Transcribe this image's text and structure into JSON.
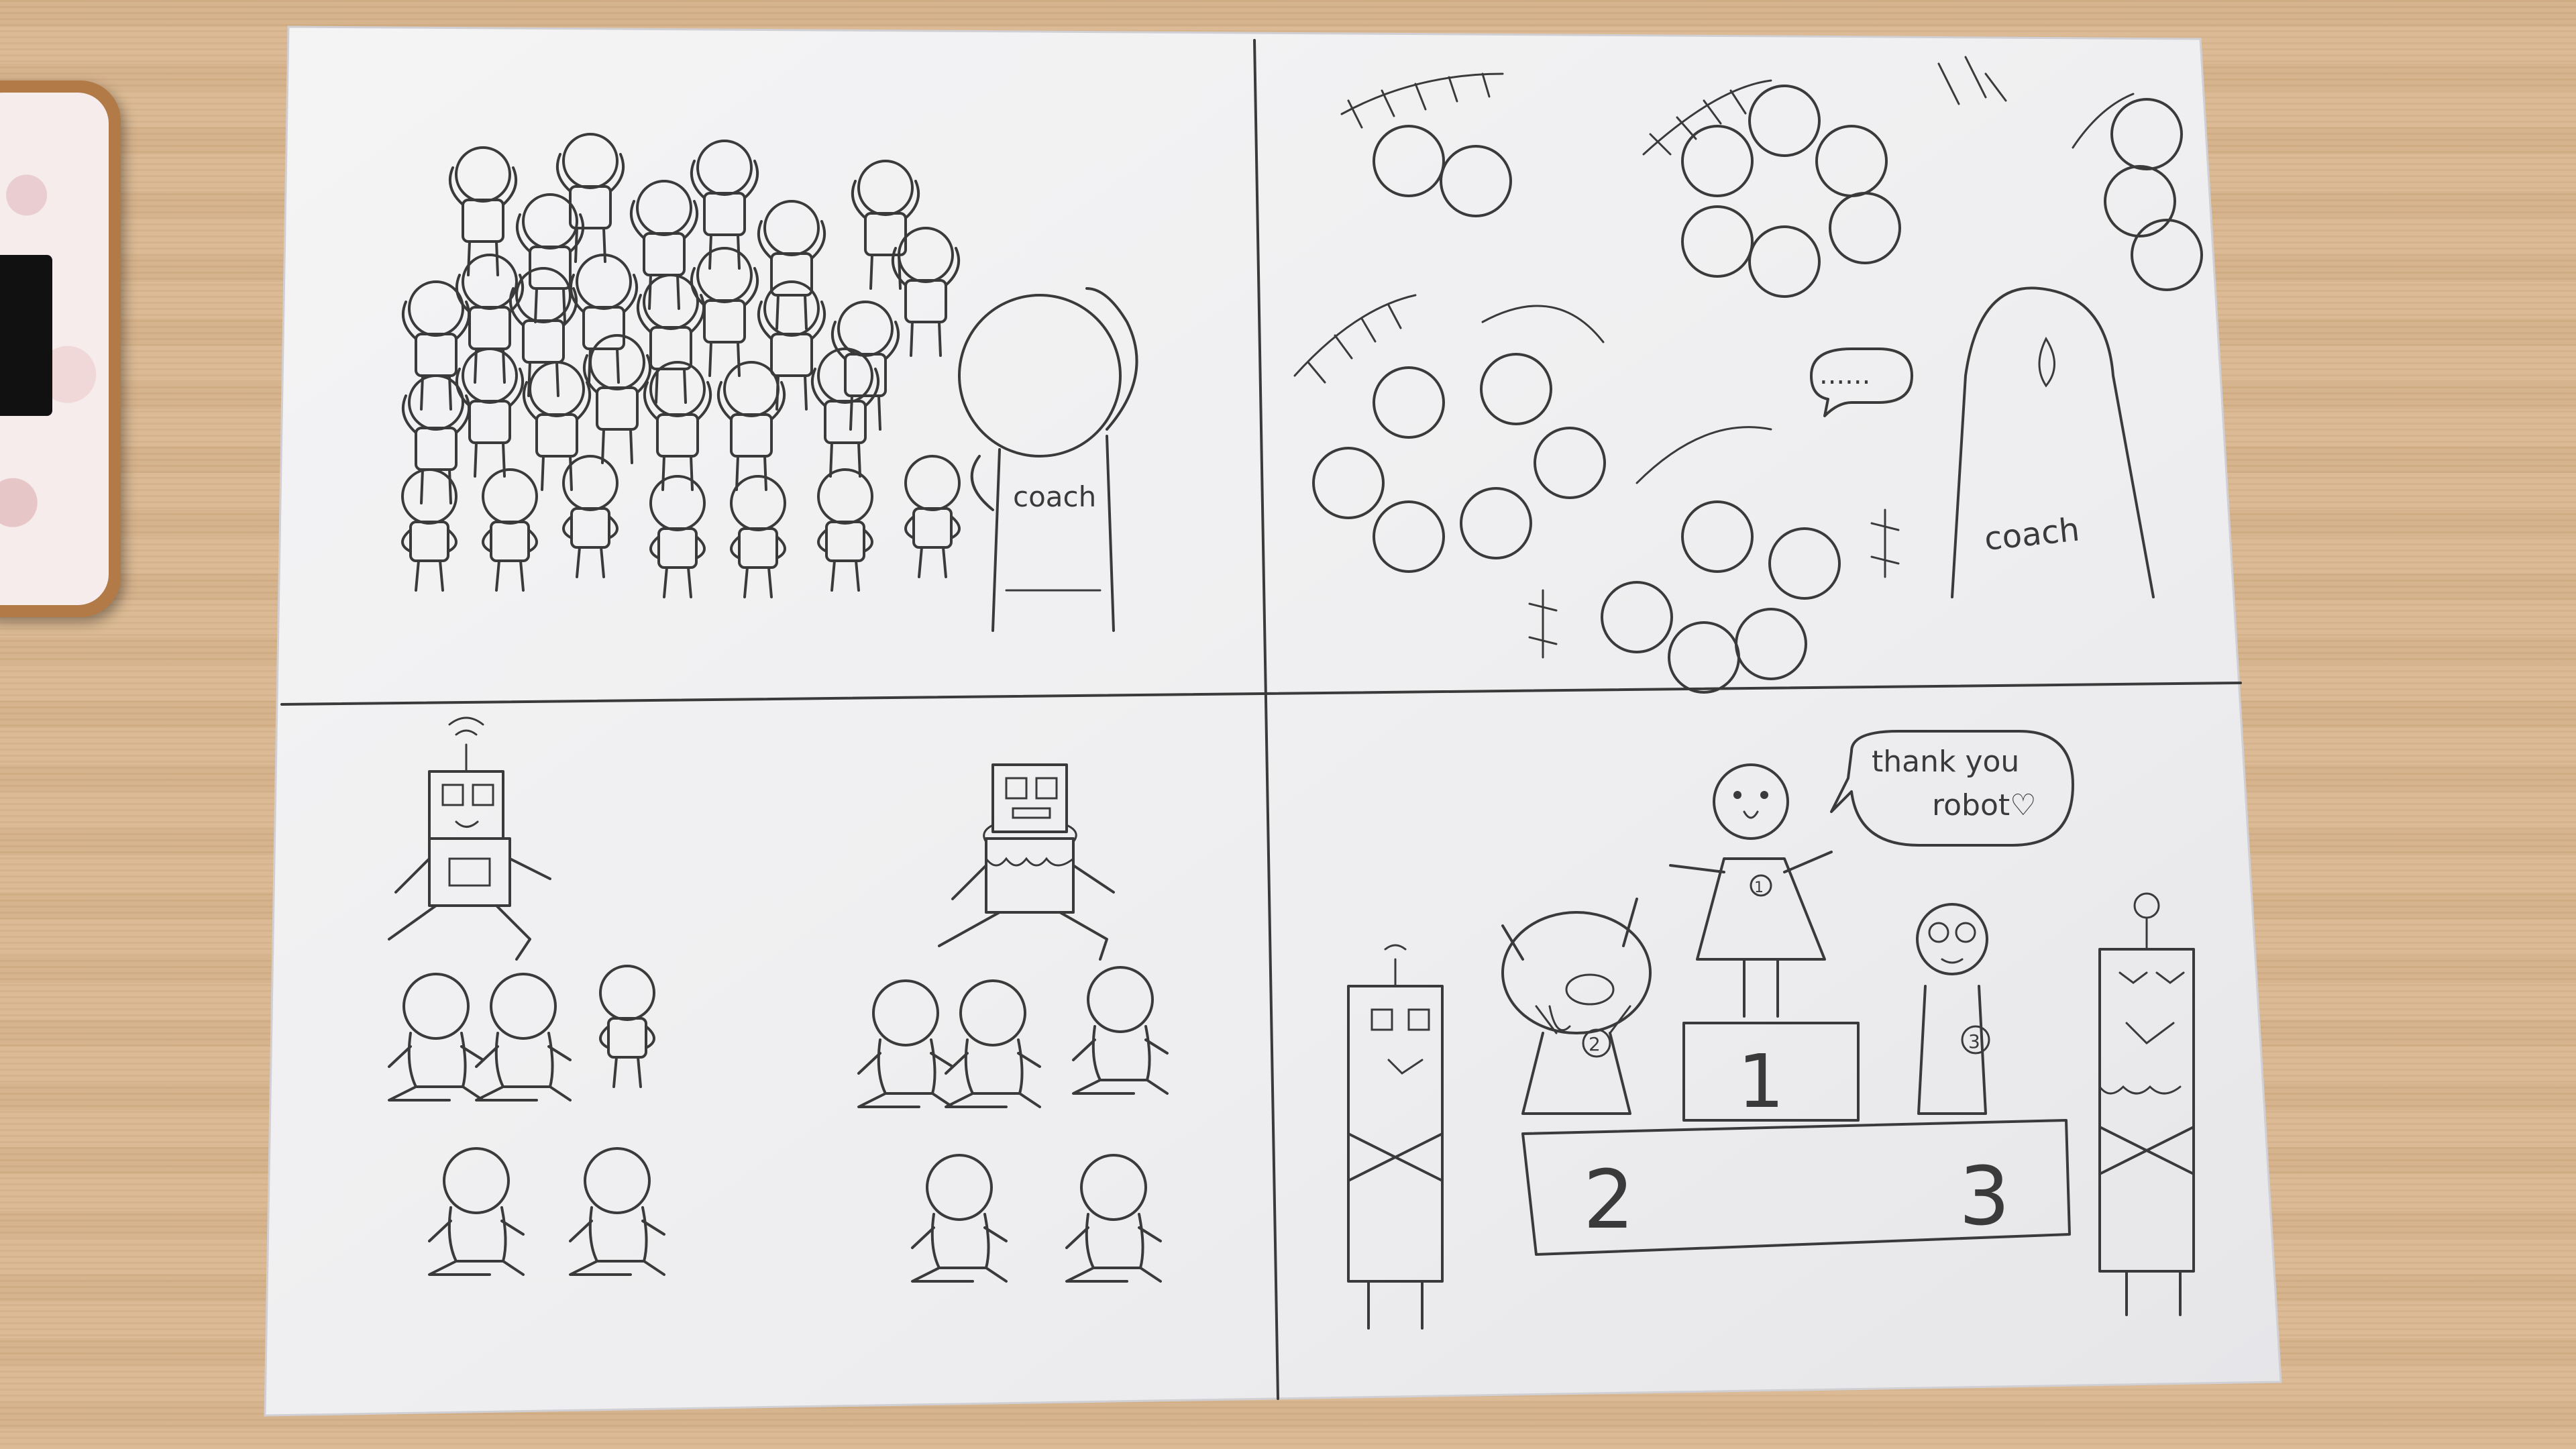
{
  "panels": {
    "top_left": {
      "coach_label": "coach"
    },
    "top_right": {
      "speech": "......",
      "coach_label": "coach"
    },
    "bottom_left": {},
    "bottom_right": {
      "speech_line1": "thank you",
      "speech_line2": "robot♡",
      "podium_first": "1",
      "podium_second": "2",
      "podium_third": "3",
      "medal_first": "1",
      "medal_second": "2",
      "medal_third": "3"
    }
  },
  "colors": {
    "desk": "#d9b68f",
    "paper": "#f2f2f3",
    "ink": "#3a3a3a"
  }
}
